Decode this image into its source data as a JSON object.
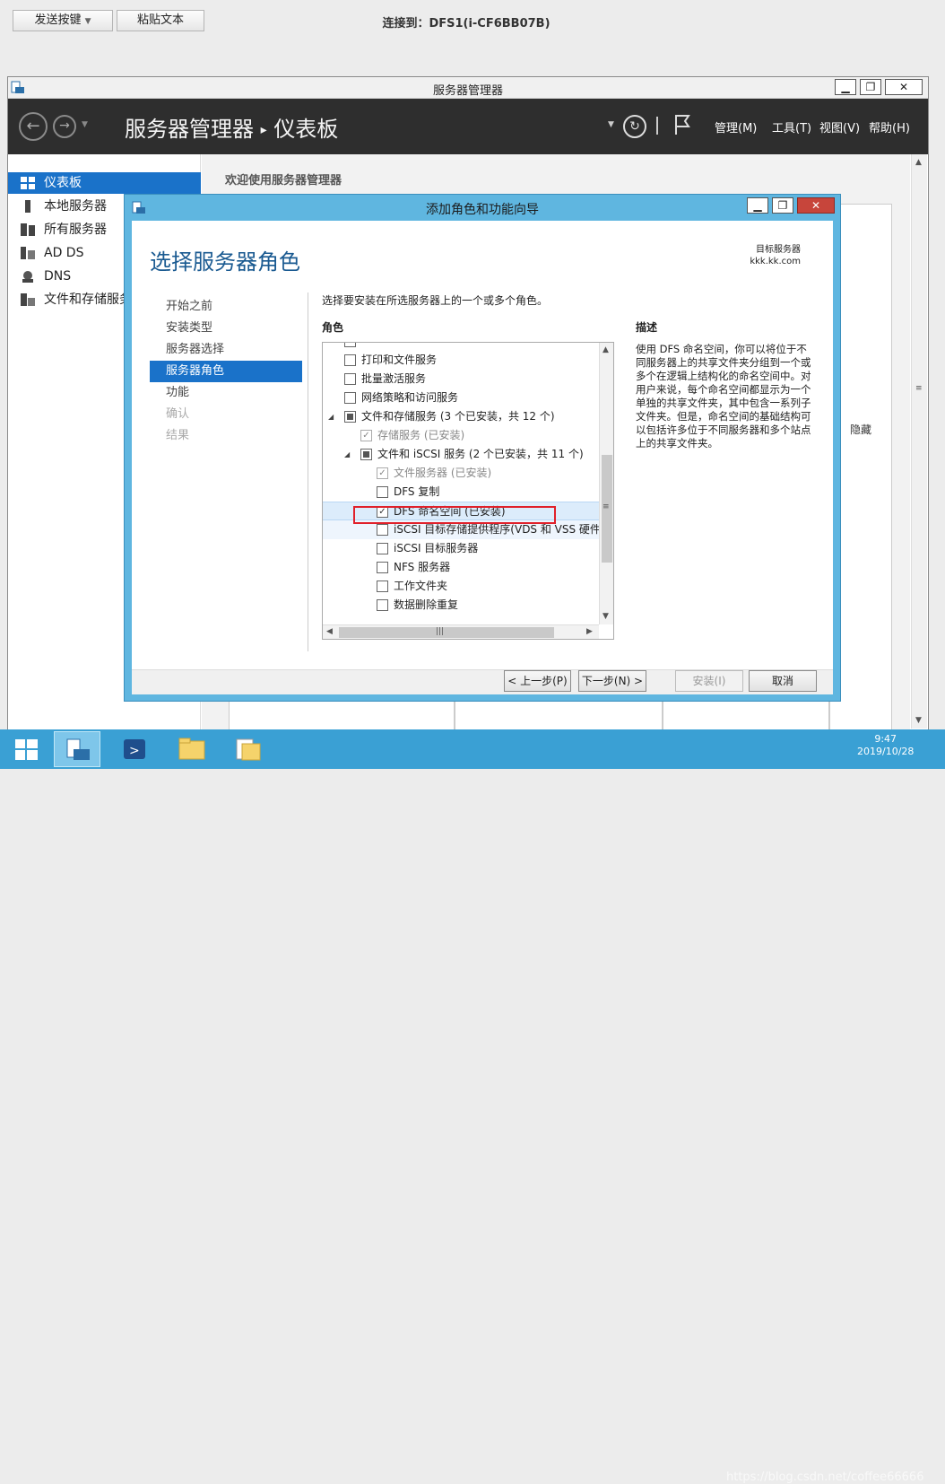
{
  "rdp": {
    "send_keys_label": "发送按键",
    "paste_text_label": "粘贴文本",
    "connection_title": "连接到：DFS1(i-CF6BB07B)"
  },
  "server_manager": {
    "window_title": "服务器管理器",
    "breadcrumb_root": "服务器管理器",
    "breadcrumb_separator": "▸",
    "breadcrumb_current": "仪表板",
    "menus": [
      "管理(M)",
      "工具(T)",
      "视图(V)",
      "帮助(H)"
    ],
    "sidebar": [
      {
        "label": "仪表板",
        "icon": "dashboard-icon",
        "active": true
      },
      {
        "label": "本地服务器",
        "icon": "server-icon",
        "active": false
      },
      {
        "label": "所有服务器",
        "icon": "servers-icon",
        "active": false
      },
      {
        "label": "AD DS",
        "icon": "adds-icon",
        "active": false
      },
      {
        "label": "DNS",
        "icon": "dns-icon",
        "active": false
      },
      {
        "label": "文件和存储服务",
        "icon": "storage-icon",
        "active": false
      }
    ],
    "welcome": "欢迎使用服务器管理器",
    "hide_label": "隐藏"
  },
  "wizard": {
    "title": "添加角色和功能向导",
    "page_title": "选择服务器角色",
    "target_label": "目标服务器",
    "target_server": "kkk.kk.com",
    "steps": [
      {
        "label": "开始之前",
        "state": "normal"
      },
      {
        "label": "安装类型",
        "state": "normal"
      },
      {
        "label": "服务器选择",
        "state": "normal"
      },
      {
        "label": "服务器角色",
        "state": "active"
      },
      {
        "label": "功能",
        "state": "normal"
      },
      {
        "label": "确认",
        "state": "disabled"
      },
      {
        "label": "结果",
        "state": "disabled"
      }
    ],
    "instruction": "选择要安装在所选服务器上的一个或多个角色。",
    "roles_heading": "角色",
    "description_heading": "描述",
    "description": "使用 DFS 命名空间，你可以将位于不同服务器上的共享文件夹分组到一个或多个在逻辑上结构化的命名空间中。对用户来说，每个命名空间都显示为一个单独的共享文件夹，其中包含一系列子文件夹。但是，命名空间的基础结构可以包括许多位于不同服务器和多个站点上的共享文件夹。",
    "roles": [
      {
        "label": "打印和文件服务",
        "indent": 0,
        "state": "unchecked",
        "expander": ""
      },
      {
        "label": "批量激活服务",
        "indent": 0,
        "state": "unchecked",
        "expander": ""
      },
      {
        "label": "网络策略和访问服务",
        "indent": 0,
        "state": "unchecked",
        "expander": ""
      },
      {
        "label": "文件和存储服务 (3 个已安装，共 12 个)",
        "indent": 0,
        "state": "partial",
        "expander": "◢"
      },
      {
        "label": "存储服务 (已安装)",
        "indent": 1,
        "state": "checked-disabled",
        "expander": ""
      },
      {
        "label": "文件和 iSCSI 服务 (2 个已安装，共 11 个)",
        "indent": 1,
        "state": "partial",
        "expander": "◢"
      },
      {
        "label": "文件服务器 (已安装)",
        "indent": 2,
        "state": "checked-disabled",
        "expander": ""
      },
      {
        "label": "DFS 复制",
        "indent": 2,
        "state": "unchecked",
        "expander": ""
      },
      {
        "label": "DFS 命名空间 (已安装)",
        "indent": 2,
        "state": "checked",
        "expander": "",
        "selected": true
      },
      {
        "label": "iSCSI 目标存储提供程序(VDS 和 VSS 硬件提",
        "indent": 2,
        "state": "unchecked",
        "expander": "",
        "hover": true
      },
      {
        "label": "iSCSI 目标服务器",
        "indent": 2,
        "state": "unchecked",
        "expander": ""
      },
      {
        "label": "NFS 服务器",
        "indent": 2,
        "state": "unchecked",
        "expander": ""
      },
      {
        "label": "工作文件夹",
        "indent": 2,
        "state": "unchecked",
        "expander": ""
      },
      {
        "label": "数据删除重复",
        "indent": 2,
        "state": "unchecked",
        "expander": ""
      }
    ],
    "buttons": {
      "previous": "< 上一步(P)",
      "next": "下一步(N) >",
      "install": "安装(I)",
      "cancel": "取消"
    }
  },
  "taskbar": {
    "time": "9:47",
    "date": "2019/10/28",
    "watermark": "https://blog.csdn.net/coffee66666"
  }
}
